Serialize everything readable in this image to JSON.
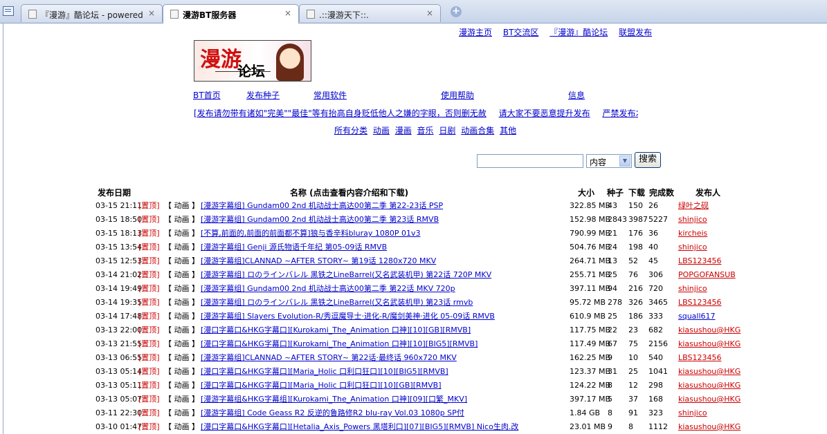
{
  "browser": {
    "tabs": [
      {
        "title": "『漫游』酷论坛 - powered by..."
      },
      {
        "title": "漫游BT服务器"
      },
      {
        "title": ".::漫游天下::."
      }
    ],
    "close_glyph": "×",
    "new_tab_glyph": "+"
  },
  "top_links": [
    "漫游主页",
    "BT交流区",
    "『漫游』酷论坛",
    "联盟发布"
  ],
  "logo": {
    "text1": "漫游",
    "text2": "论坛"
  },
  "nav": [
    "BT首页",
    "发布种子",
    "常用软件",
    "使用帮助",
    "信息"
  ],
  "marquee": [
    "[发布请勿带有诸如\"完美\"\"最佳\"等有抬高自身贬低他人之嫌的字眼，否则删无赦",
    "请大家不要恶意提升发布",
    "严禁发布才"
  ],
  "categories": [
    "所有分类",
    "动画",
    "漫画",
    "音乐",
    "日剧",
    "动画合集",
    "其他"
  ],
  "search": {
    "select_value": "内容",
    "button": "搜索"
  },
  "table": {
    "headers": {
      "date": "发布日期",
      "name": "名称 (点击查看内容介绍和下载)",
      "size": "大小",
      "seeds": "种子",
      "downloads": "下载",
      "completed": "完成数",
      "publisher": "发布人"
    },
    "rows": [
      {
        "date": "03-15 21:11",
        "pin": "[置顶]",
        "cat": "【 动画 】",
        "name": "[漫游字幕组] Gundam00 2nd 机动战士高达00第二季 第22-23话 PSP",
        "size": "322.85 MB",
        "seeds": "43",
        "downloads": "150",
        "completed": "26",
        "publisher": "绿叶之砚",
        "pub_color": "red"
      },
      {
        "date": "03-15 18:50",
        "pin": "[置顶]",
        "cat": "【 动画 】",
        "name": "[漫游字幕组] Gundam00 2nd 机动战士高达00第二季 第23话 RMVB",
        "size": "152.98 MB",
        "seeds": "2843",
        "downloads": "3987",
        "completed": "5227",
        "publisher": "shinjico",
        "pub_color": "red"
      },
      {
        "date": "03-15 18:13",
        "pin": "[置顶]",
        "cat": "【 动画 】",
        "name": "[不算,前面的,前面的前面都不算]狼与香辛料bluray 1080P 01v3",
        "size": "790.99 MB",
        "seeds": "21",
        "downloads": "176",
        "completed": "36",
        "publisher": "kircheis",
        "pub_color": "red"
      },
      {
        "date": "03-15 13:54",
        "pin": "[置顶]",
        "cat": "【 动画 】",
        "name": "[漫游字幕组] Genji 源氏物语千年纪 第05-09话 RMVB",
        "size": "504.76 MB",
        "seeds": "24",
        "downloads": "198",
        "completed": "40",
        "publisher": "shinjico",
        "pub_color": "red"
      },
      {
        "date": "03-15 12:53",
        "pin": "[置顶]",
        "cat": "【 动画 】",
        "name": "[漫游字幕组]CLANNAD ~AFTER STORY~ 第19话 1280x720 MKV",
        "size": "264.71 MB",
        "seeds": "13",
        "downloads": "52",
        "completed": "45",
        "publisher": "LBS123456",
        "pub_color": "red"
      },
      {
        "date": "03-14 21:02",
        "pin": "[置顶]",
        "cat": "【 动画 】",
        "name": "[漫游字幕组] ロのラインバレル 黑铁之LineBarrel(又名武装机甲) 第22话 720P MKV",
        "size": "255.71 MB",
        "seeds": "25",
        "downloads": "76",
        "completed": "306",
        "publisher": "POPGOFANSUB",
        "pub_color": "red"
      },
      {
        "date": "03-14 19:49",
        "pin": "[置顶]",
        "cat": "【 动画 】",
        "name": "[漫游字幕组] Gundam00 2nd 机动战士高达00第二季 第22话 MKV 720p",
        "size": "397.11 MB",
        "seeds": "94",
        "downloads": "216",
        "completed": "720",
        "publisher": "shinjico",
        "pub_color": "red"
      },
      {
        "date": "03-14 19:35",
        "pin": "[置顶]",
        "cat": "【 动画 】",
        "name": "[漫游字幕组] ロのラインバレル 黑铁之LineBarrel(又名武装机甲) 第23话 rmvb",
        "size": "95.72 MB",
        "seeds": "278",
        "downloads": "326",
        "completed": "3465",
        "publisher": "LBS123456",
        "pub_color": "red"
      },
      {
        "date": "03-14 17:48",
        "pin": "[置顶]",
        "cat": "【 动画 】",
        "name": "[漫游字幕组] Slayers Evolution-R/秀逗魔导士·进化-R/魔剑美神·进化 05-09话 RMVB",
        "size": "610.9 MB",
        "seeds": "25",
        "downloads": "186",
        "completed": "333",
        "publisher": "squall617",
        "pub_color": "blue"
      },
      {
        "date": "03-13 22:00",
        "pin": "[置顶]",
        "cat": "【 动画 】",
        "name": "[漫口字幕口&HKG字幕口][Kurokami_The_Animation 口神][10][GB][RMVB]",
        "size": "117.75 MB",
        "seeds": "22",
        "downloads": "23",
        "completed": "682",
        "publisher": "kiasushou@HKG",
        "pub_color": "red"
      },
      {
        "date": "03-13 21:55",
        "pin": "[置顶]",
        "cat": "【 动画 】",
        "name": "[漫口字幕口&HKG字幕口][Kurokami_The_Animation 口神][10][BIG5][RMVB]",
        "size": "117.49 MB",
        "seeds": "67",
        "downloads": "75",
        "completed": "2156",
        "publisher": "kiasushou@HKG",
        "pub_color": "red"
      },
      {
        "date": "03-13 06:55",
        "pin": "[置顶]",
        "cat": "【 动画 】",
        "name": "[漫游字幕组]CLANNAD ~AFTER STORY~ 第22话·最终话 960x720 MKV",
        "size": "162.25 MB",
        "seeds": "9",
        "downloads": "10",
        "completed": "540",
        "publisher": "LBS123456",
        "pub_color": "red"
      },
      {
        "date": "03-13 05:14",
        "pin": "[置顶]",
        "cat": "【 动画 】",
        "name": "[漫口字幕口&HKG字幕口][Maria_Holic 口利口狂口][10][BIG5][RMVB]",
        "size": "123.37 MB",
        "seeds": "31",
        "downloads": "25",
        "completed": "1041",
        "publisher": "kiasushou@HKG",
        "pub_color": "red"
      },
      {
        "date": "03-13 05:11",
        "pin": "[置顶]",
        "cat": "【 动画 】",
        "name": "[漫口字幕口&HKG字幕口][Maria_Holic 口利口狂口][10][GB][RMVB]",
        "size": "124.22 MB",
        "seeds": "8",
        "downloads": "12",
        "completed": "298",
        "publisher": "kiasushou@HKG",
        "pub_color": "red"
      },
      {
        "date": "03-13 05:07",
        "pin": "[置顶]",
        "cat": "【 动画 】",
        "name": "[漫游字幕组&HKG字幕组][Kurokami_The_Animation 口神][09][口繁_MKV]",
        "size": "397.17 MB",
        "seeds": "5",
        "downloads": "37",
        "completed": "168",
        "publisher": "kiasushou@HKG",
        "pub_color": "red"
      },
      {
        "date": "03-11 22:30",
        "pin": "[置顶]",
        "cat": "【 动画 】",
        "name": "[漫游字幕组] Code Geass R2 反逆的鲁路修R2 blu-ray Vol.03 1080p SP付",
        "size": "1.84 GB",
        "seeds": "8",
        "downloads": "91",
        "completed": "323",
        "publisher": "shinjico",
        "pub_color": "red"
      },
      {
        "date": "03-10 01:47",
        "pin": "[置顶]",
        "cat": "【 动画 】",
        "name": "[漫口字幕口&HKG字幕口][Hetalia_Axis_Powers 黑塔利口][07][BIG5][RMVB] Nico生肉.改",
        "size": "23.01 MB",
        "seeds": "9",
        "downloads": "8",
        "completed": "1112",
        "publisher": "kiasushou@HKG",
        "pub_color": "red"
      }
    ]
  }
}
